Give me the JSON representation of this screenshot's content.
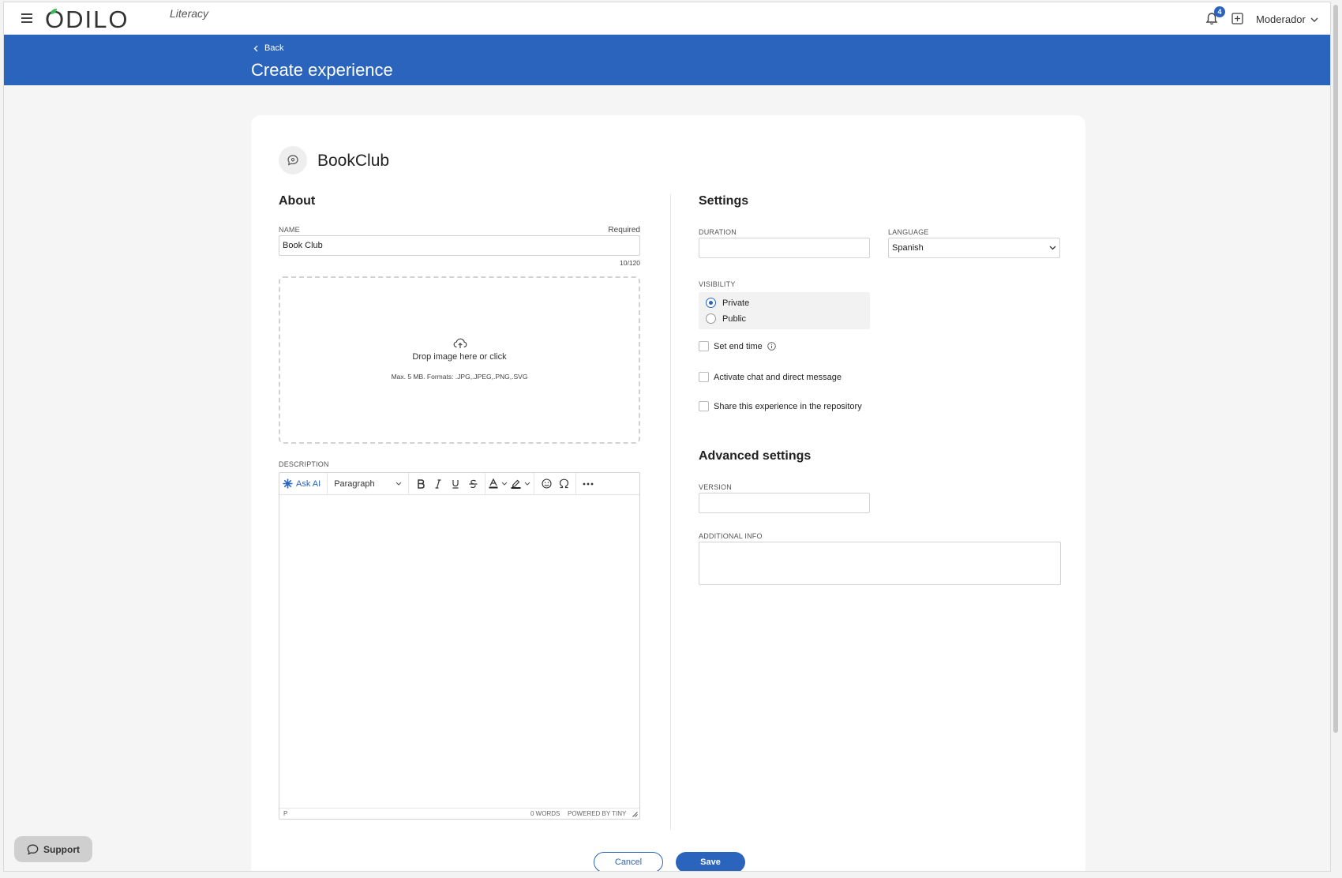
{
  "topbar": {
    "logo_text": "ODILO",
    "logo_sub": "Literacy",
    "notification_count": "4",
    "user_name": "Moderador"
  },
  "banner": {
    "back_label": "Back",
    "page_title": "Create experience"
  },
  "experience": {
    "name": "BookClub"
  },
  "about": {
    "title": "About",
    "name_label": "NAME",
    "required_label": "Required",
    "name_value": "Book Club",
    "char_count": "10/120",
    "drop_main": "Drop image here or click",
    "drop_sub": "Max. 5 MB. Formats: .JPG,.JPEG,.PNG,.SVG",
    "description_label": "DESCRIPTION"
  },
  "editor": {
    "ask_ai": "Ask AI",
    "block_format": "Paragraph",
    "path": "P",
    "word_count": "0 WORDS",
    "powered_by": "POWERED BY TINY"
  },
  "settings": {
    "title": "Settings",
    "duration_label": "DURATION",
    "duration_value": "",
    "language_label": "LANGUAGE",
    "language_value": "Spanish",
    "visibility_label": "VISIBILITY",
    "visibility_options": [
      "Private",
      "Public"
    ],
    "visibility_selected": "Private",
    "set_end_time": "Set end time",
    "activate_chat": "Activate chat and direct message",
    "share_repo": "Share this experience in the repository",
    "advanced_title": "Advanced settings",
    "version_label": "VERSION",
    "version_value": "",
    "additional_label": "ADDITIONAL INFO",
    "additional_value": ""
  },
  "actions": {
    "cancel": "Cancel",
    "save": "Save"
  },
  "support": {
    "label": "Support"
  },
  "colors": {
    "brand": "#2a64bc",
    "background": "#f5f5f5",
    "card": "#ffffff"
  }
}
